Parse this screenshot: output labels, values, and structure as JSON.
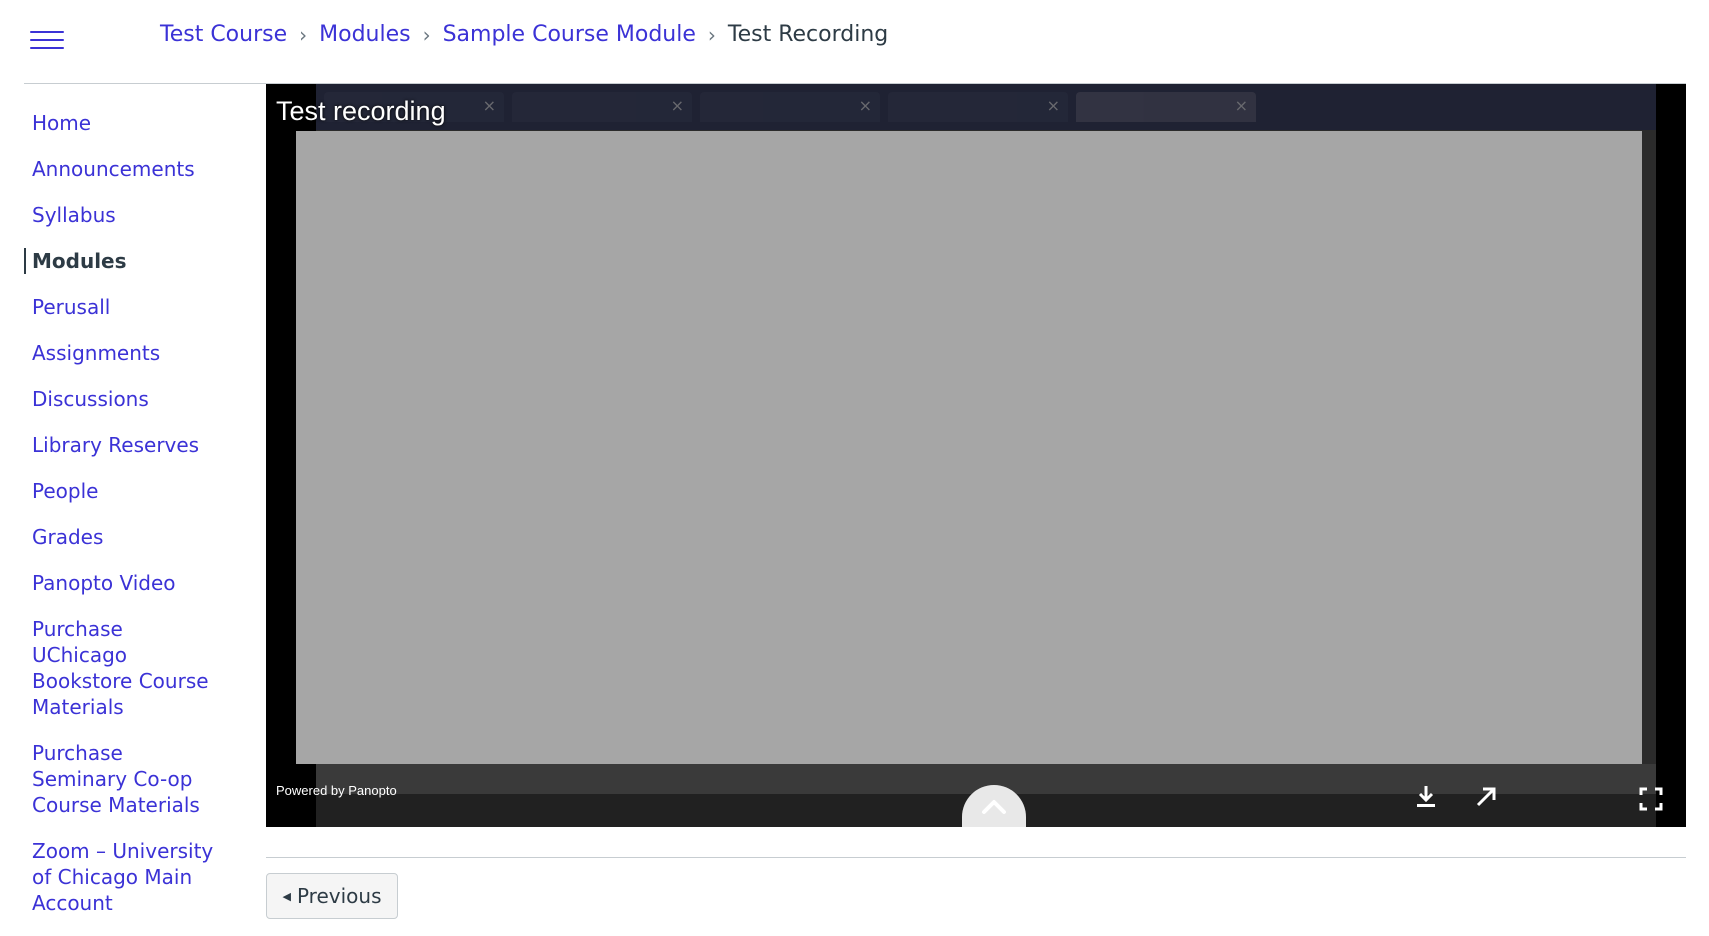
{
  "breadcrumb": [
    {
      "label": "Test Course"
    },
    {
      "label": "Modules"
    },
    {
      "label": "Sample Course Module"
    },
    {
      "label": "Test Recording"
    }
  ],
  "sidebar": {
    "items": [
      {
        "label": "Home"
      },
      {
        "label": "Announcements"
      },
      {
        "label": "Syllabus"
      },
      {
        "label": "Modules",
        "active": true
      },
      {
        "label": "Perusall"
      },
      {
        "label": "Assignments"
      },
      {
        "label": "Discussions"
      },
      {
        "label": "Library Reserves"
      },
      {
        "label": "People"
      },
      {
        "label": "Grades"
      },
      {
        "label": "Panopto Video"
      },
      {
        "label": "Purchase UChicago Bookstore Course Materials"
      },
      {
        "label": "Purchase Seminary Co-op Course Materials"
      },
      {
        "label": "Zoom – University of Chicago Main Account"
      }
    ]
  },
  "player": {
    "title": "Test recording",
    "powered_by": "Powered by Panopto"
  },
  "navigation": {
    "previous_label": "Previous"
  },
  "colors": {
    "link": "#3b32d6",
    "text": "#2d3b45",
    "player_bg": "#000000",
    "video_placeholder": "#a6a6a6"
  }
}
